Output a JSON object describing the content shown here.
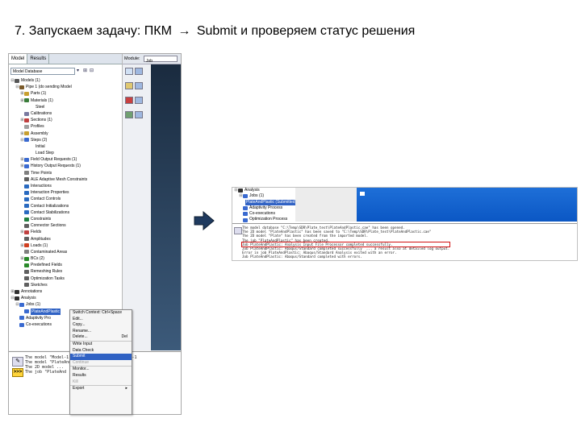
{
  "slide": {
    "title_before": "7. Запускаем задачу: ПКМ",
    "title_arrow": "→",
    "title_after": "Submit и проверяем статус решения"
  },
  "abaqus_left": {
    "tabs": [
      "Model",
      "Results"
    ],
    "model_selector": "Model Database",
    "module_label": "Module:",
    "module_value": "Job",
    "tree": [
      {
        "label": "Models (1)",
        "indent": 0,
        "exp": "⊟",
        "color": "#555555"
      },
      {
        "label": "Pipe 1 (do sending Model",
        "indent": 1,
        "exp": "⊟",
        "color": "#7a5a2a"
      },
      {
        "label": "Parts (1)",
        "indent": 2,
        "exp": "⊞",
        "color": "#c8a030"
      },
      {
        "label": "Materials (1)",
        "indent": 2,
        "exp": "⊞",
        "color": "#3a7d3a"
      },
      {
        "label": "Steel",
        "indent": 3,
        "exp": "",
        "color": "#ffffff"
      },
      {
        "label": "Calibrations",
        "indent": 2,
        "exp": "",
        "color": "#7a7aa0"
      },
      {
        "label": "Sections (1)",
        "indent": 2,
        "exp": "⊞",
        "color": "#c04040"
      },
      {
        "label": "Profiles",
        "indent": 2,
        "exp": "",
        "color": "#a0a0a0"
      },
      {
        "label": "Assembly",
        "indent": 2,
        "exp": "⊞",
        "color": "#c8a030"
      },
      {
        "label": "Steps (2)",
        "indent": 2,
        "exp": "⊟",
        "color": "#3a6ad0"
      },
      {
        "label": "Initial",
        "indent": 3,
        "exp": "",
        "color": "#ffffff"
      },
      {
        "label": "Load Step",
        "indent": 3,
        "exp": "",
        "color": "#ffffff"
      },
      {
        "label": "Field Output Requests (1)",
        "indent": 2,
        "exp": "⊞",
        "color": "#3a6ad0"
      },
      {
        "label": "History Output Requests (1)",
        "indent": 2,
        "exp": "⊞",
        "color": "#3a6ad0"
      },
      {
        "label": "Time Points",
        "indent": 2,
        "exp": "",
        "color": "#808080"
      },
      {
        "label": "ALE Adaptive Mesh Constraints",
        "indent": 2,
        "exp": "",
        "color": "#606060"
      },
      {
        "label": "Interactions",
        "indent": 2,
        "exp": "",
        "color": "#2a6ac0"
      },
      {
        "label": "Interaction Properties",
        "indent": 2,
        "exp": "",
        "color": "#2a6ac0"
      },
      {
        "label": "Contact Controls",
        "indent": 2,
        "exp": "",
        "color": "#2a6ac0"
      },
      {
        "label": "Contact Initializations",
        "indent": 2,
        "exp": "",
        "color": "#2a6ac0"
      },
      {
        "label": "Contact Stabilizations",
        "indent": 2,
        "exp": "",
        "color": "#2a6ac0"
      },
      {
        "label": "Constraints",
        "indent": 2,
        "exp": "",
        "color": "#208040"
      },
      {
        "label": "Connector Sections",
        "indent": 2,
        "exp": "",
        "color": "#606060"
      },
      {
        "label": "Fields",
        "indent": 2,
        "exp": "⊞",
        "color": "#c04040"
      },
      {
        "label": "Amplitudes",
        "indent": 2,
        "exp": "",
        "color": "#606060"
      },
      {
        "label": "Loads (1)",
        "indent": 2,
        "exp": "⊞",
        "color": "#d04020"
      },
      {
        "label": "Contaminated Areas",
        "indent": 2,
        "exp": "",
        "color": "#808080"
      },
      {
        "label": "BCs (2)",
        "indent": 2,
        "exp": "⊞",
        "color": "#2a8a2a"
      },
      {
        "label": "Predefined Fields",
        "indent": 2,
        "exp": "",
        "color": "#2a8a2a"
      },
      {
        "label": "Remeshing Rules",
        "indent": 2,
        "exp": "",
        "color": "#606060"
      },
      {
        "label": "Optimization Tasks",
        "indent": 2,
        "exp": "",
        "color": "#606060"
      },
      {
        "label": "Sketches",
        "indent": 2,
        "exp": "",
        "color": "#606060"
      },
      {
        "label": "Annotations",
        "indent": 0,
        "exp": "⊞",
        "color": "#303030"
      },
      {
        "label": "Analysis",
        "indent": 0,
        "exp": "⊟",
        "color": "#303030"
      },
      {
        "label": "Jobs (1)",
        "indent": 1,
        "exp": "⊟",
        "color": "#3a6ad0"
      },
      {
        "label": "PlateAndPlastic",
        "indent": 2,
        "exp": "",
        "color": "#3a6ad0",
        "highlight": true
      },
      {
        "label": "Adaptivity Pro",
        "indent": 1,
        "exp": "",
        "color": "#3a6ad0"
      },
      {
        "label": "Co-executions",
        "indent": 1,
        "exp": "",
        "color": "#3a6ad0"
      }
    ],
    "messages": [
      "The model \"Model-1\" has been created.  Model-1",
      "The model \"PlateAndPlastic\" ... from the",
      "The 2D model ...     created from the",
      "The job \"PlateAnd  ...  created"
    ],
    "prompt_label": ">>>",
    "context_menu": [
      {
        "label": "Switch Context: Ctrl+Space",
        "state": "normal",
        "sep": false
      },
      {
        "label": "Edit...",
        "state": "normal",
        "sep": false
      },
      {
        "label": "Copy...",
        "state": "normal",
        "sep": false
      },
      {
        "label": "Rename...",
        "state": "normal",
        "sep": false
      },
      {
        "label": "Delete...",
        "key": "Del",
        "state": "normal",
        "sep": false
      },
      {
        "label": "Write Input",
        "state": "normal",
        "sep": true
      },
      {
        "label": "Data Check",
        "state": "normal",
        "sep": false
      },
      {
        "label": "Submit",
        "state": "highlight",
        "sep": false
      },
      {
        "label": "Continue",
        "state": "disabled",
        "sep": false
      },
      {
        "label": "Monitor...",
        "state": "normal",
        "sep": true
      },
      {
        "label": "Results",
        "state": "normal",
        "sep": false
      },
      {
        "label": "Kill",
        "state": "disabled",
        "sep": false
      },
      {
        "label": "Export",
        "state": "normal",
        "sep": true,
        "submenu": "▸"
      }
    ]
  },
  "abaqus_right": {
    "tree": [
      {
        "label": "Analysis",
        "indent": 0,
        "exp": "⊟",
        "color": "#303030"
      },
      {
        "label": "Jobs (1)",
        "indent": 1,
        "exp": "⊟",
        "color": "#3a6ad0"
      },
      {
        "label": "PlateAndPlastic (Submitted)",
        "indent": 2,
        "exp": "",
        "color": "#3a6ad0",
        "highlight": true
      },
      {
        "label": "Adaptivity Process",
        "indent": 1,
        "exp": "",
        "color": "#3a6ad0"
      },
      {
        "label": "Co-executions",
        "indent": 1,
        "exp": "",
        "color": "#3a6ad0"
      },
      {
        "label": "Optimization Process",
        "indent": 1,
        "exp": "",
        "color": "#3a6ad0"
      }
    ],
    "messages": [
      {
        "text": "The model database \"C:\\Temp\\SDR\\Plate_test\\PlateAndPlastic.cae\" has been opened.",
        "highlight": false
      },
      {
        "text": "The 2D model \"PlateAndPlastic\" has been saved to \"C:\\Temp\\SDR\\Plate_test\\PlateAndPlastic.cae\"",
        "highlight": false
      },
      {
        "text": "The 2D model \"Plate\" has been created from the imported model.",
        "highlight": false
      },
      {
        "text": "The job \"PlateAndPlastic\" has been created.",
        "highlight": false
      },
      {
        "text": "Job PlateAndPlastic: Analysis Input File Processor completed successfully.",
        "highlight": true
      },
      {
        "text": "Job PlateAndPlastic: Abaqus/Standard completed successfully  ... a result also at detailed log output.",
        "highlight": false
      },
      {
        "text": "Error in job PlateAndPlastic: Abaqus/Standard Analysis exited with an error.",
        "highlight": false
      },
      {
        "text": "Job PlateAndPlastic: Abaqus/Standard completed with errors.",
        "highlight": false
      }
    ]
  }
}
